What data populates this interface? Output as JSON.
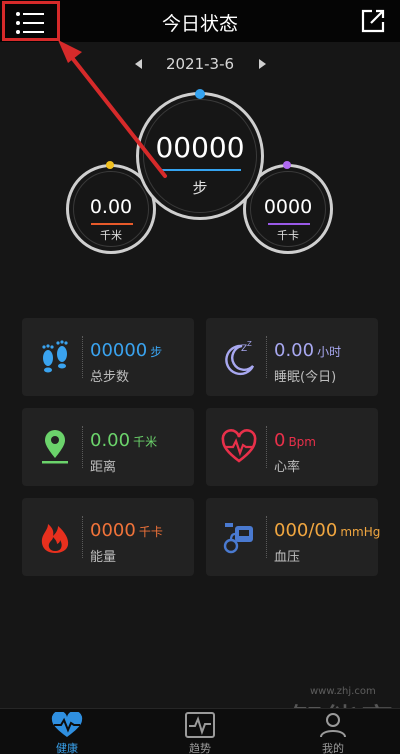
{
  "header": {
    "title": "今日状态",
    "menu_icon": "menu-list-icon",
    "edit_icon": "edit-icon",
    "highlight_color": "#d62a2a"
  },
  "date": {
    "value": "2021-3-6",
    "prev_icon": "triangle-left-icon",
    "next_icon": "triangle-right-icon"
  },
  "gauges": {
    "steps": {
      "value": "00000",
      "unit": "步",
      "accent": "#35a3f0"
    },
    "distance": {
      "value": "0.00",
      "unit": "千米",
      "accent": "#e85a2a"
    },
    "calories": {
      "value": "0000",
      "unit": "千卡",
      "accent": "#9a5ae8"
    }
  },
  "cards": {
    "steps": {
      "value": "00000",
      "unit": "步",
      "label": "总步数",
      "color": "#3aa3ef",
      "icon": "footprints-icon"
    },
    "sleep": {
      "value": "0.00",
      "unit": "小时",
      "label": "睡眠(今日)",
      "color": "#a8a8f0",
      "icon": "moon-sleep-icon"
    },
    "distance": {
      "value": "0.00",
      "unit": "千米",
      "label": "距离",
      "color": "#6bd36b",
      "icon": "location-pin-icon"
    },
    "heart": {
      "value": "0",
      "unit": "Bpm",
      "label": "心率",
      "color": "#e8304a",
      "icon": "heart-pulse-icon"
    },
    "energy": {
      "value": "0000",
      "unit": "千卡",
      "label": "能量",
      "color": "#f0733a",
      "icon": "flame-icon"
    },
    "pressure": {
      "value": "000/00",
      "unit": "mmHg",
      "label": "血压",
      "color": "#f0a640",
      "icon": "blood-pressure-icon"
    }
  },
  "nav": {
    "items": [
      {
        "label": "健康",
        "icon": "heart-pulse-icon",
        "active": true
      },
      {
        "label": "趋势",
        "icon": "trend-chart-icon",
        "active": false
      },
      {
        "label": "我的",
        "icon": "user-icon",
        "active": false
      }
    ]
  },
  "watermark": {
    "text": "智能家",
    "url": "www.zhj.com"
  }
}
